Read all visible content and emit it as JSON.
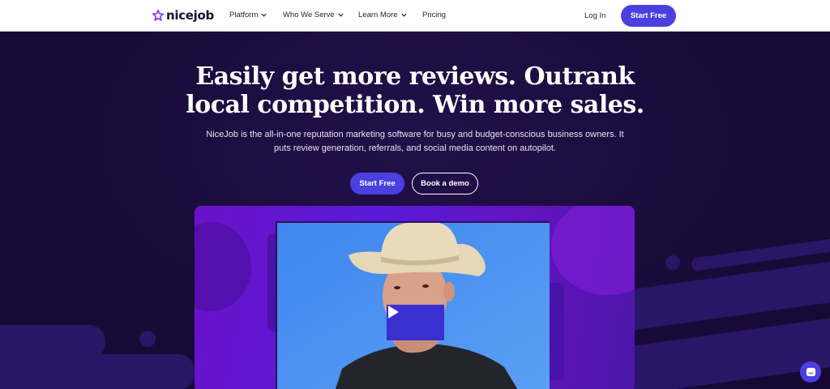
{
  "nav": {
    "logo_text": "nicejob",
    "links": [
      "Platform",
      "Who We Serve",
      "Learn More",
      "Pricing"
    ],
    "login_label": "Log In",
    "start_label": "Start Free"
  },
  "hero": {
    "headline_line1": "Easily get more reviews. Outrank",
    "headline_line2": "local competition. Win more sales.",
    "subtext": "NiceJob is the all-in-one reputation marketing software for busy and budget-conscious business owners. It puts review generation, referrals, and social media content on autopilot.",
    "start_label": "Start Free",
    "demo_label": "Book a demo"
  },
  "colors": {
    "accent": "#4a40e0",
    "hero_bg": "#1a0b3b",
    "logo_star": "#8a3ce0"
  },
  "icons": [
    "star-logo-icon",
    "chevron-down-icon",
    "play-icon",
    "chat-icon"
  ]
}
